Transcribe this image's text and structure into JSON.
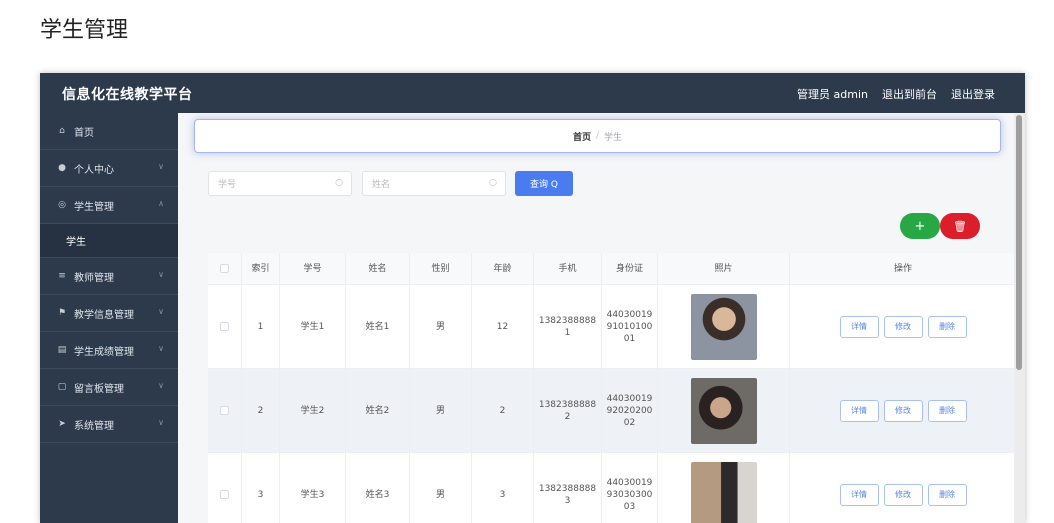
{
  "page": {
    "title": "学生管理"
  },
  "topbar": {
    "brand": "信息化在线教学平台",
    "admin": "管理员 admin",
    "to_front": "退出到前台",
    "logout": "退出登录"
  },
  "sidebar": {
    "items": [
      {
        "label": "首页",
        "icon": "home-icon"
      },
      {
        "label": "个人中心",
        "icon": "user-icon"
      },
      {
        "label": "学生管理",
        "icon": "globe-icon",
        "sub": "学生"
      },
      {
        "label": "教师管理",
        "icon": "menu-icon"
      },
      {
        "label": "教学信息管理",
        "icon": "flag-icon"
      },
      {
        "label": "学生成绩管理",
        "icon": "clipboard-icon"
      },
      {
        "label": "留言板管理",
        "icon": "message-icon"
      },
      {
        "label": "系统管理",
        "icon": "send-icon"
      }
    ]
  },
  "breadcrumb": {
    "home": "首页",
    "sep": "/",
    "current": "学生"
  },
  "search": {
    "xuehao_placeholder": "学号",
    "name_placeholder": "姓名",
    "query_label": "查询 Q"
  },
  "actions": {
    "add_label": "+",
    "delete_label": "🗑"
  },
  "table": {
    "headers": [
      "索引",
      "学号",
      "姓名",
      "性别",
      "年龄",
      "手机",
      "身份证",
      "照片",
      "操作"
    ],
    "rows": [
      {
        "index": "1",
        "xuehao": "学生1",
        "name": "姓名1",
        "gender": "男",
        "age": "12",
        "phone": "13823888881",
        "idcard": "440300199101010001"
      },
      {
        "index": "2",
        "xuehao": "学生2",
        "name": "姓名2",
        "gender": "男",
        "age": "2",
        "phone": "13823888882",
        "idcard": "440300199202020002"
      },
      {
        "index": "3",
        "xuehao": "学生3",
        "name": "姓名3",
        "gender": "男",
        "age": "3",
        "phone": "13823888883",
        "idcard": "440300199303030003"
      }
    ],
    "op_labels": {
      "detail": "详情",
      "edit": "修改",
      "delete": "删除"
    }
  },
  "colors": {
    "topbar": "#2d3a4b",
    "primary": "#4a7cf0",
    "add": "#28a745",
    "delete": "#dc1e2a"
  }
}
